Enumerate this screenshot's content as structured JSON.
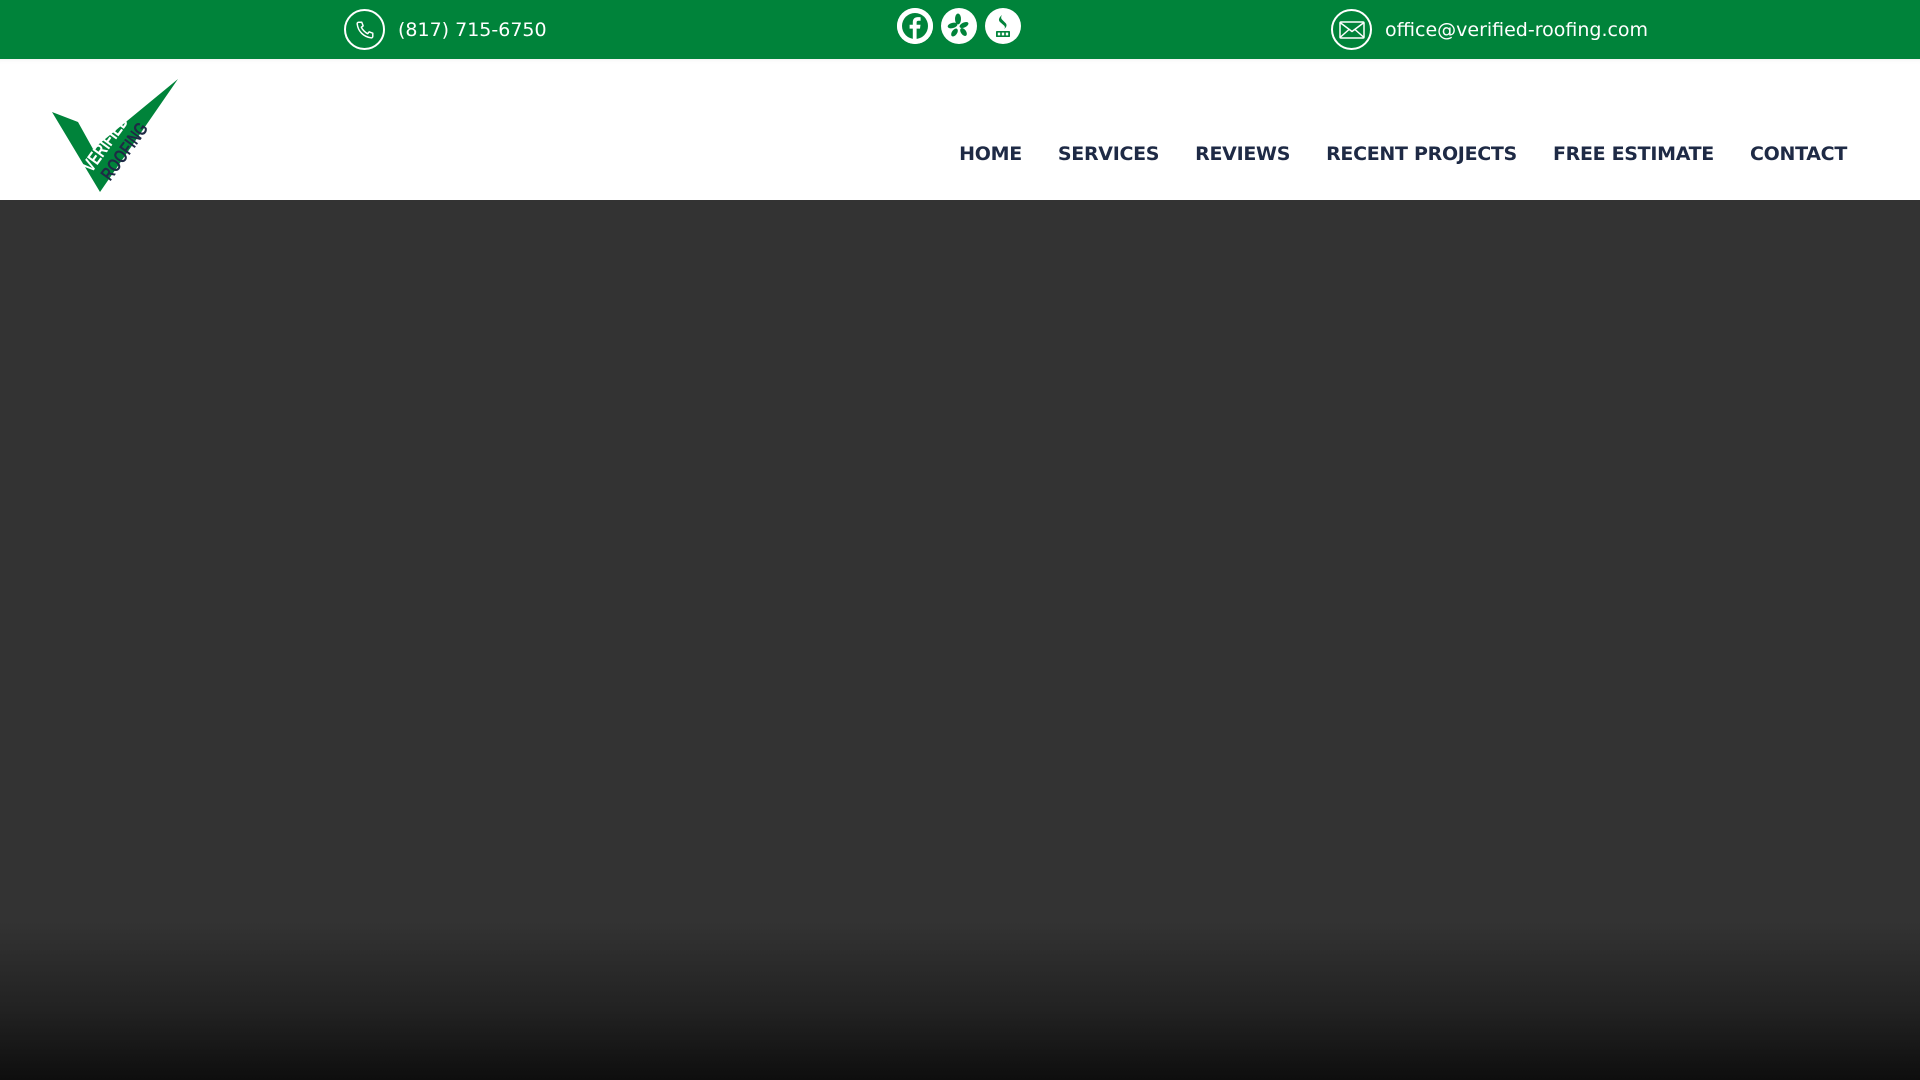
{
  "topbar": {
    "background": "#00833a",
    "phone": {
      "icon": "phone-icon",
      "text": "(817) 715-6750"
    },
    "socials": [
      {
        "icon": "facebook-icon"
      },
      {
        "icon": "yelp-icon"
      },
      {
        "icon": "bbb-icon"
      }
    ],
    "email": {
      "icon": "mail-icon",
      "text": "office@verified-roofing.com"
    }
  },
  "header": {
    "logo": {
      "line1": "VERIFIED",
      "line2": "ROOFING",
      "brand_color": "#00833a",
      "text_color": "#1e2a45"
    },
    "nav": [
      "HOME",
      "SERVICES",
      "REVIEWS",
      "RECENT PROJECTS",
      "FREE ESTIMATE",
      "CONTACT"
    ],
    "nav_color": "#1e2a45"
  },
  "hero": {
    "background": "#333333"
  }
}
